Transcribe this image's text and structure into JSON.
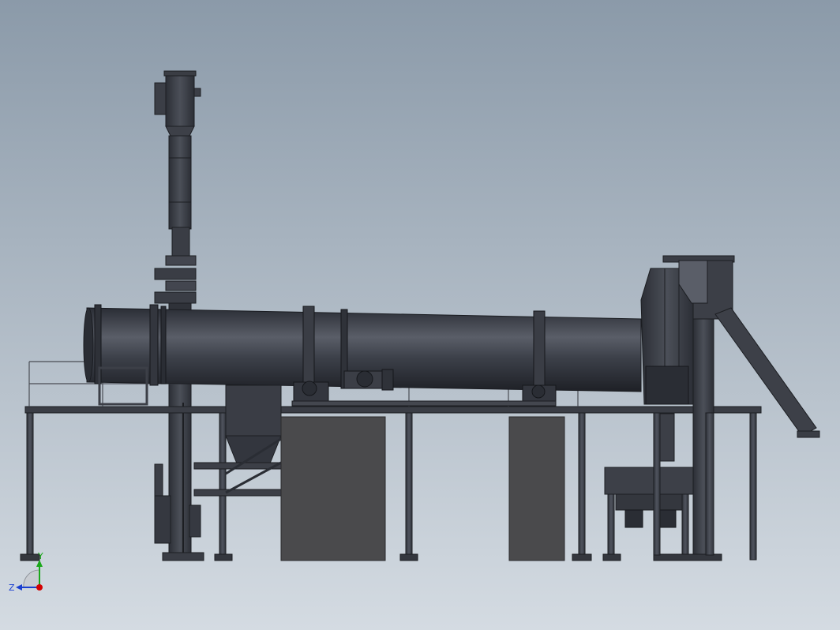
{
  "model": {
    "name": "rotary-dryer-assembly"
  },
  "triad": {
    "x_label": "",
    "y_label": "Y",
    "z_label": "Z",
    "x_color": "#d40000",
    "y_color": "#1aa81a",
    "z_color": "#1a3fd0"
  },
  "colors": {
    "background_top": "#8b9aa9",
    "background_bottom": "#d4dbe2",
    "steel": "#3f434c",
    "steel_dark": "#2b2e35",
    "panel": "#4a4a4c"
  }
}
